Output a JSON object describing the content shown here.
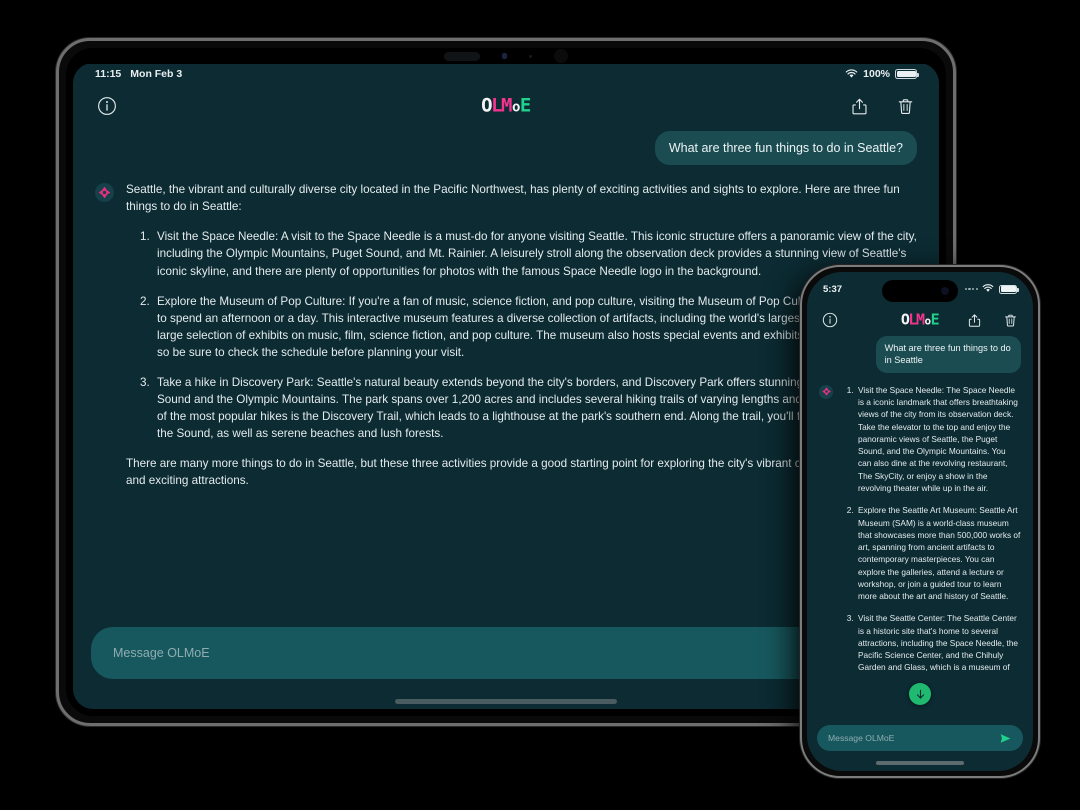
{
  "ipad": {
    "status": {
      "time": "11:15",
      "date": "Mon Feb 3",
      "battery_pct": "100%",
      "wifi_icon": "wifi-icon",
      "battery_icon": "battery-icon"
    },
    "toolbar": {
      "info_label": "i",
      "brand": {
        "part1": "O",
        "part2": "L",
        "part3": "M",
        "part4": "o",
        "part5": "E",
        "full": "OLMoE"
      },
      "share_icon": "share-icon",
      "trash_icon": "trash-icon"
    },
    "conversation": {
      "user_message": "What are three fun things to do in Seattle?",
      "assistant_intro": "Seattle, the vibrant and culturally diverse city located in the Pacific Northwest, has plenty of exciting activities and sights to explore. Here are three fun things to do in Seattle:",
      "assistant_items": [
        "Visit the Space Needle: A visit to the Space Needle is a must-do for anyone visiting Seattle. This iconic structure offers a panoramic view of the city, including the Olympic Mountains, Puget Sound, and Mt. Rainier. A leisurely stroll along the observation deck provides a stunning view of Seattle's iconic skyline, and there are plenty of opportunities for photos with the famous Space Needle logo in the background.",
        "Explore the Museum of Pop Culture: If you're a fan of music, science fiction, and pop culture, visiting the Museum of Pop Culture is a fantastic way to spend an afternoon or a day. This interactive museum features a diverse collection of artifacts, including the world's largest vinyl collection and a large selection of exhibits on music, film, science fiction, and pop culture. The museum also hosts special events and exhibits throughout the year, so be sure to check the schedule before planning your visit.",
        "Take a hike in Discovery Park: Seattle's natural beauty extends beyond the city's borders, and Discovery Park offers stunning views of Puget Sound and the Olympic Mountains. The park spans over 1,200 acres and includes several hiking trails of varying lengths and difficulty levels. One of the most popular hikes is the Discovery Trail, which leads to a lighthouse at the park's southern end. Along the trail, you'll find stunning views of the Sound, as well as serene beaches and lush forests."
      ],
      "assistant_outro": "There are many more things to do in Seattle, but these three activities provide a good starting point for exploring the city's vibrant culture, natural beauty, and exciting attractions."
    },
    "input": {
      "placeholder": "Message OLMoE",
      "value": ""
    }
  },
  "iphone": {
    "status": {
      "time": "5:37",
      "wifi_icon": "wifi-icon",
      "battery_icon": "battery-icon"
    },
    "toolbar": {
      "info_label": "i",
      "brand": {
        "part1": "O",
        "part2": "L",
        "part3": "M",
        "part4": "o",
        "part5": "E",
        "full": "OLMoE"
      },
      "share_icon": "share-icon",
      "trash_icon": "trash-icon"
    },
    "conversation": {
      "user_message": "What are three fun things to do in Seattle",
      "assistant_items": [
        "Visit the Space Needle: The Space Needle is a iconic landmark that offers breathtaking views of the city from its observation deck. Take the elevator to the top and enjoy the panoramic views of Seattle, the Puget Sound, and the Olympic Mountains. You can also dine at the revolving restaurant, The SkyCity, or enjoy a show in the revolving theater while up in the air.",
        "Explore the Seattle Art Museum: Seattle Art Museum (SAM) is a world-class museum that showcases more than 500,000 works of art, spanning from ancient artifacts to contemporary masterpieces. You can explore the galleries, attend a lecture or workshop, or join a guided tour to learn more about the art and history of Seattle.",
        "Visit the Seattle Center: The Seattle Center is a historic site that's home to several attractions, including the Space Needle, the Pacific Science Center, and the Chihuly Garden and Glass, which is a museum of"
      ]
    },
    "scroll_button_icon": "arrow-down-icon",
    "input": {
      "placeholder": "Message OLMoE",
      "value": "",
      "send_icon": "send-icon"
    }
  },
  "colors": {
    "screen_bg": "#0c2b33",
    "bubble": "#1a4c52",
    "input_bg": "#17585e",
    "brand_pink": "#f5338f",
    "brand_green": "#1fd18a",
    "scroll_btn_green": "#1fba6f"
  }
}
